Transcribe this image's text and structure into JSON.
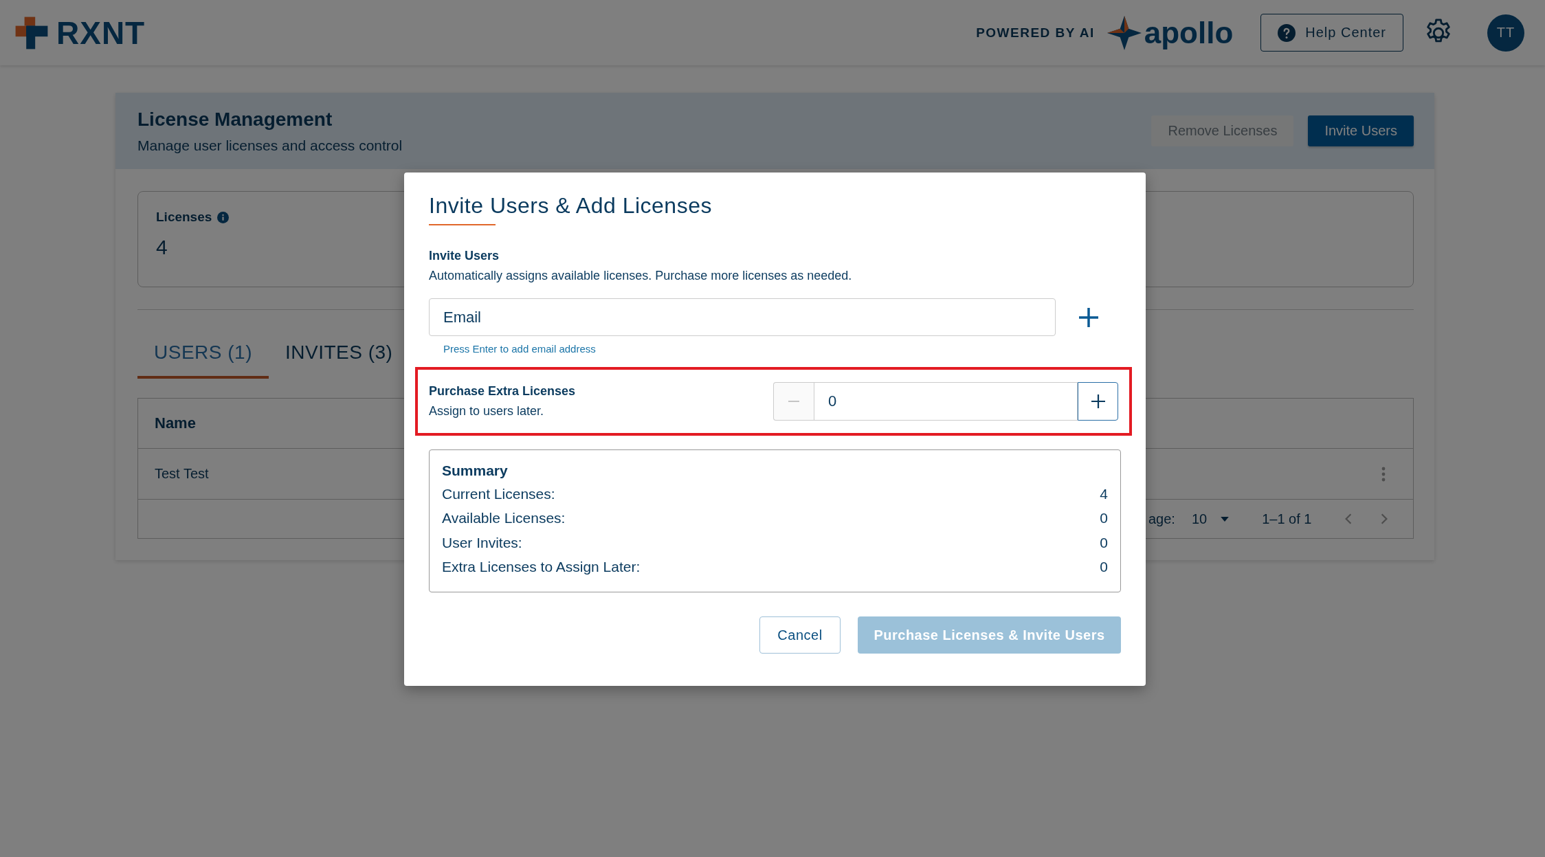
{
  "header": {
    "logo_text": "RXNT",
    "powered_by": "POWERED BY AI",
    "brand": "apollo",
    "help_button": "Help Center",
    "avatar": "TT"
  },
  "page": {
    "title": "License Management",
    "subtitle": "Manage user licenses and access control",
    "buttons": [
      {
        "label": "Remove Licenses",
        "disabled": true
      },
      {
        "label": "Invite Users",
        "disabled": false
      }
    ],
    "licenses_card": {
      "label": "Licenses",
      "value": "4"
    },
    "tabs": [
      {
        "label": "USERS (1)",
        "selected": true
      },
      {
        "label": "INVITES (3)",
        "selected": false
      }
    ],
    "table": {
      "columns": [
        "Name"
      ],
      "rows": [
        [
          "Test Test"
        ]
      ]
    },
    "pagination": {
      "rows_per_page_label": "age:",
      "rows_per_page": "10",
      "range": "1–1 of 1"
    }
  },
  "modal": {
    "title": "Invite Users & Add Licenses",
    "invite": {
      "heading": "Invite Users",
      "description": "Automatically assigns available licenses. Purchase more licenses as needed.",
      "placeholder": "Email",
      "hint": "Press Enter to add email address"
    },
    "extra": {
      "heading": "Purchase Extra Licenses",
      "description": "Assign to users later.",
      "value": "0",
      "decrement_disabled": true,
      "highlighted": true
    },
    "summary": {
      "title": "Summary",
      "rows": [
        {
          "label": "Current Licenses:",
          "value": "4"
        },
        {
          "label": "Available Licenses:",
          "value": "0"
        },
        {
          "label": "User Invites:",
          "value": "0"
        },
        {
          "label": "Extra Licenses to Assign Later:",
          "value": "0"
        }
      ]
    },
    "buttons": [
      {
        "label": "Cancel",
        "kind": "secondary",
        "disabled": false
      },
      {
        "label": "Purchase Licenses & Invite Users",
        "kind": "primary",
        "disabled": true
      }
    ]
  }
}
